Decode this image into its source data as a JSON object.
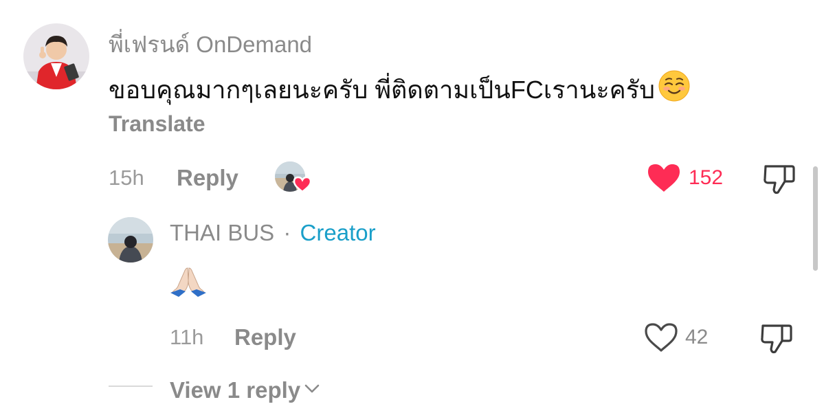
{
  "comment": {
    "author": "พี่เฟรนด์ OnDemand",
    "text": "ขอบคุณมากๆเลยนะครับ พี่ติดตามเป็นFCเรานะครับ",
    "emoji": "relieved-smiling-face",
    "translate_label": "Translate",
    "time": "15h",
    "reply_label": "Reply",
    "liked_by_creator": true,
    "likes": "152",
    "liked": true
  },
  "reply": {
    "author": "THAI BUS",
    "separator": "·",
    "badge": "Creator",
    "emoji": "folded-hands",
    "time": "11h",
    "reply_label": "Reply",
    "likes": "42",
    "liked": false
  },
  "view_replies_label": "View 1 reply",
  "colors": {
    "like_active": "#fe2c55",
    "creator_badge": "#1a9fc9",
    "muted_text": "#8a8a8a",
    "primary_text": "#111111"
  }
}
